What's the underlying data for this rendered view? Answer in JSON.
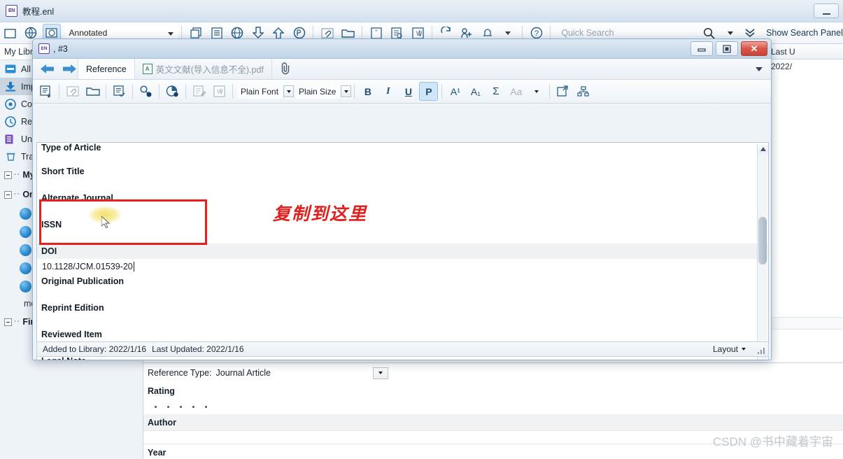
{
  "main_window": {
    "title": "教程.enl",
    "logo_text": "EN",
    "minimize_label": "–"
  },
  "main_toolbar": {
    "style_combo_value": "Annotated",
    "quick_search_placeholder": "Quick Search",
    "show_search_panel_label": "Show Search Panel",
    "icons": [
      "new-folder-icon",
      "online-search-icon",
      "online-search-folder-icon",
      "copy-reference-icon",
      "list-view-icon",
      "globe-icon",
      "import-icon",
      "export-icon",
      "pdf-icon",
      "attach-file-icon",
      "open-folder-icon",
      "quote-icon",
      "edit-reference-icon",
      "word-icon",
      "refresh-icon",
      "add-user-icon",
      "alert-icon",
      "help-icon",
      "search-icon"
    ]
  },
  "sidebar": {
    "header_label": "My Libr",
    "items": [
      {
        "label": "All",
        "icon": "all-references-icon",
        "selected": false
      },
      {
        "label": "Imp",
        "icon": "imported-icon",
        "selected": true
      },
      {
        "label": "Con",
        "icon": "configure-icon",
        "selected": false
      },
      {
        "label": "Rec",
        "icon": "recently-added-icon",
        "selected": false
      },
      {
        "label": "Unf",
        "icon": "unfiled-icon",
        "selected": false
      },
      {
        "label": "Tras",
        "icon": "trash-icon",
        "selected": false
      }
    ],
    "groups": [
      {
        "label": "My",
        "icon": "expander-icon"
      },
      {
        "label": "Onl",
        "icon": "expander-icon"
      },
      {
        "label": "Fin",
        "icon": "expander-icon"
      }
    ],
    "online_children": [
      {
        "label": "",
        "icon": "globe-icon"
      },
      {
        "label": "",
        "icon": "globe-icon"
      },
      {
        "label": "",
        "icon": "globe-icon"
      },
      {
        "label": "",
        "icon": "globe-icon"
      },
      {
        "label": "",
        "icon": "globe-icon"
      }
    ],
    "more_label": "mo"
  },
  "reference_list": {
    "columns": [
      "al",
      "Last U"
    ],
    "rows": [
      {
        "col1": "",
        "col2": "2022/"
      }
    ]
  },
  "preview_pane": {
    "reference_type_label": "Reference Type:",
    "reference_type_value": "Journal Article",
    "fields": [
      {
        "label": "Rating",
        "shaded": false
      },
      {
        "label": "Author",
        "shaded": true
      },
      {
        "label": "Year",
        "shaded": false
      }
    ],
    "rating_stars": 5
  },
  "dialog": {
    "logo_text": "EN",
    "title": ", #3",
    "window_buttons": {
      "minimize": "–",
      "restore": "❐",
      "close": "✕"
    },
    "nav": {
      "back_icon": "arrow-left-icon",
      "forward_icon": "arrow-right-icon"
    },
    "tabs": [
      {
        "label": "Reference",
        "icon": "",
        "active": true
      },
      {
        "label": "英文文献(导入信息不全).pdf",
        "icon": "pdf-icon",
        "active": false
      }
    ],
    "attachment_icon": "paperclip-icon",
    "format_toolbar": {
      "font_combo": "Plain Font",
      "size_combo": "Plain Size",
      "bold_label": "B",
      "italic_label": "I",
      "underline_label": "U",
      "plain_label": "P",
      "superscript_label": "A¹",
      "subscript_label": "A₁",
      "sigma_label": "Σ",
      "case_label": "Aa"
    },
    "fields": [
      {
        "label": "Type of Article",
        "value": null,
        "shaded": false,
        "clipped": true
      },
      {
        "label": "Short Title",
        "value": null,
        "shaded": false
      },
      {
        "label": "Alternate Journal",
        "value": null,
        "shaded": false
      },
      {
        "label": "ISSN",
        "value": null,
        "shaded": false
      },
      {
        "label": "DOI",
        "value": "10.1128/JCM.01539-20",
        "shaded": true,
        "highlighted": true
      },
      {
        "label": "Original Publication",
        "value": null,
        "shaded": false
      },
      {
        "label": "Reprint Edition",
        "value": null,
        "shaded": false
      },
      {
        "label": "Reviewed Item",
        "value": null,
        "shaded": false
      },
      {
        "label": "Legal Note",
        "value": null,
        "shaded": false
      }
    ],
    "statusbar": {
      "added_to_library": "Added to Library: 2022/1/16",
      "last_updated": "Last Updated: 2022/1/16",
      "layout_label": "Layout"
    }
  },
  "annotations": {
    "instruction_text": "复制到这里",
    "instruction_color": "#e0201f",
    "highlight_box_color": "#e81f1f"
  },
  "watermark": {
    "text": "CSDN @书中藏着宇宙"
  }
}
